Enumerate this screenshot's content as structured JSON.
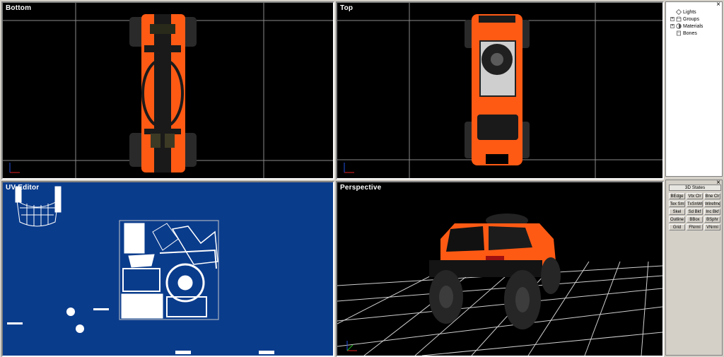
{
  "viewports": {
    "bottom": {
      "title": "Bottom"
    },
    "top": {
      "title": "Top"
    },
    "uv": {
      "title": "UV Editor"
    },
    "perspective": {
      "title": "Perspective"
    }
  },
  "tree": {
    "items": [
      {
        "label": "Lights",
        "expandable": false,
        "icon": "light-icon"
      },
      {
        "label": "Groups",
        "expandable": true,
        "icon": "groups-icon"
      },
      {
        "label": "Materials",
        "expandable": true,
        "icon": "materials-icon"
      },
      {
        "label": "Bones",
        "expandable": false,
        "icon": "bones-icon"
      }
    ]
  },
  "states": {
    "title": "3D States",
    "buttons": [
      [
        "BEdge",
        "Vtx Clr",
        "Bne Clr"
      ],
      [
        "Tex Sm",
        "TxSnWr",
        "Wirefme"
      ],
      [
        "Skel",
        "Sd Bkf",
        "Inc Bkf"
      ],
      [
        "Outline",
        "BBox",
        "BSphr"
      ],
      [
        "Grid",
        "FNrml",
        "VNrml"
      ]
    ]
  },
  "colors": {
    "vehicle": "#ff5a14",
    "uv_background": "#0a3c8c",
    "grid": "#ffffff",
    "axis_x": "#e02020",
    "axis_y": "#2050e0"
  }
}
